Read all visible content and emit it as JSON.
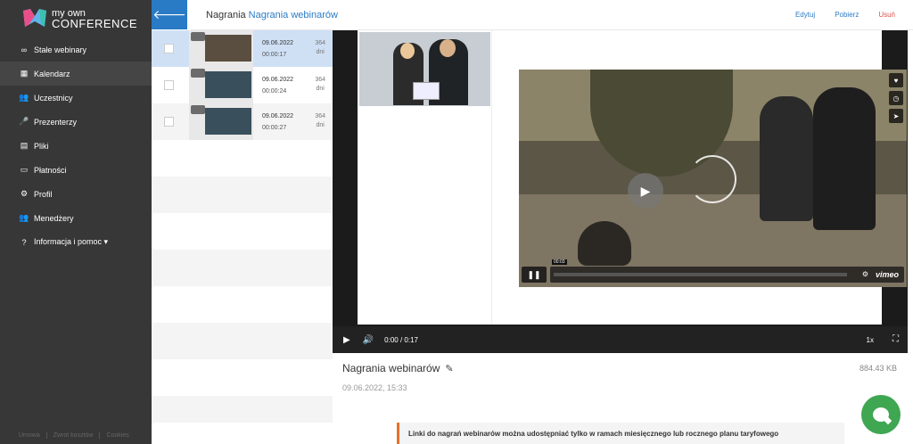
{
  "logo": {
    "line1": "my own",
    "line2": "CONFERENCE"
  },
  "sidebar": {
    "items": [
      {
        "label": "Stałe webinary",
        "icon": "infinity-icon",
        "glyph": "∞"
      },
      {
        "label": "Kalendarz",
        "icon": "calendar-icon",
        "glyph": "▦"
      },
      {
        "label": "Uczestnicy",
        "icon": "users-icon",
        "glyph": "👥"
      },
      {
        "label": "Prezenterzy",
        "icon": "presenter-icon",
        "glyph": "🎤"
      },
      {
        "label": "Pliki",
        "icon": "files-icon",
        "glyph": "▤"
      },
      {
        "label": "Płatności",
        "icon": "payment-icon",
        "glyph": "▭"
      },
      {
        "label": "Profil",
        "icon": "gear-icon",
        "glyph": "⚙"
      },
      {
        "label": "Menedżery",
        "icon": "managers-icon",
        "glyph": "👥"
      },
      {
        "label": "Informacja i pomoc ▾",
        "icon": "help-icon",
        "glyph": "?"
      }
    ],
    "active_index": 1,
    "footer": [
      "Umowa",
      "Zwrot kosztów",
      "Cookies"
    ]
  },
  "header": {
    "crumb_root": "Nagrania",
    "crumb_current": "Nagrania webinarów",
    "edit": "Edytuj",
    "download": "Pobierz",
    "delete": "Usuń"
  },
  "recordings": [
    {
      "date": "09.06.2022",
      "duration": "00:00:17",
      "days": "364",
      "days_unit": "dni",
      "selected": true
    },
    {
      "date": "09.06.2022",
      "duration": "00:00:24",
      "days": "364",
      "days_unit": "dni",
      "selected": false
    },
    {
      "date": "09.06.2022",
      "duration": "00:00:27",
      "days": "364",
      "days_unit": "dni",
      "selected": false
    }
  ],
  "vimeo": {
    "time": "00:03",
    "brand": "vimeo"
  },
  "player": {
    "time": "0:00 / 0:17",
    "speed": "1x"
  },
  "info": {
    "title": "Nagrania webinarów",
    "size": "884.43 KB",
    "date": "09.06.2022, 15:33"
  },
  "toast": "Linki do nagrań webinarów można udostępniać tylko w ramach miesięcznego lub rocznego planu taryfowego",
  "colors": {
    "accent": "#2a7bc5",
    "sidebar": "#373737",
    "danger": "#d9534f",
    "warning": "#e8702a",
    "chat": "#3fa652"
  }
}
